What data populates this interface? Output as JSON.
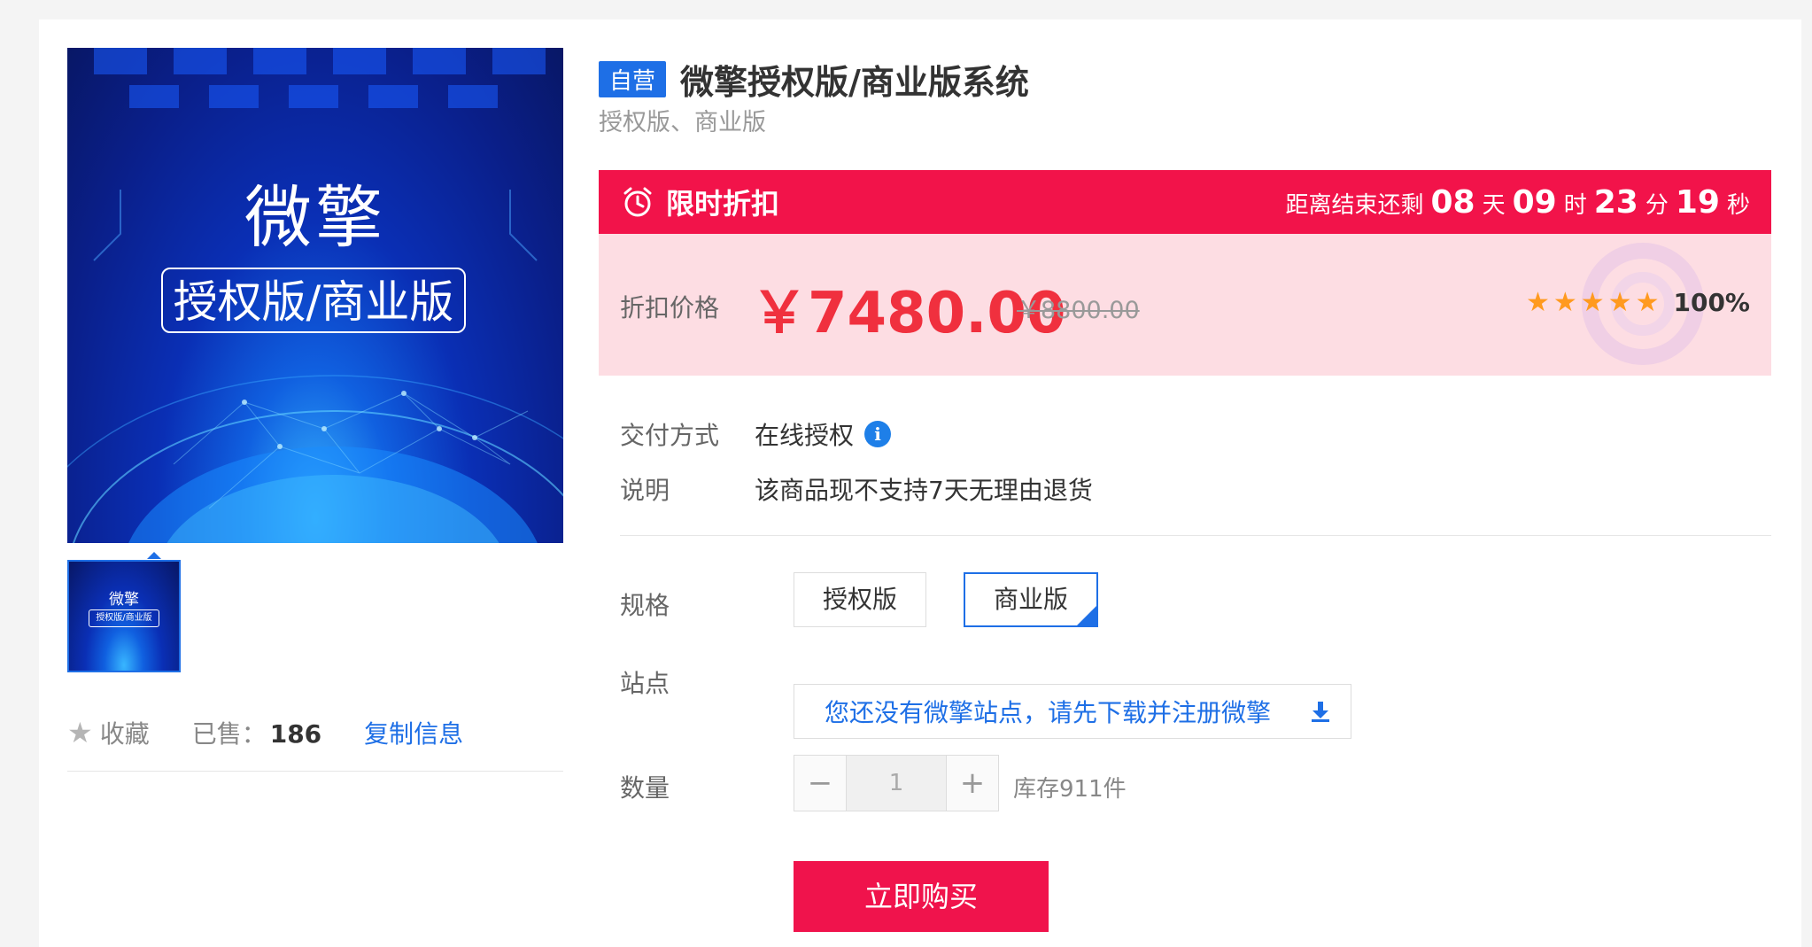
{
  "gallery": {
    "main_image_title": "微擎",
    "main_image_subtitle": "授权版/商业版",
    "thumb_title": "微擎",
    "thumb_subtitle": "授权版/商业版"
  },
  "meta": {
    "favorite_label": "收藏",
    "sold_label": "已售：",
    "sold_count": "186",
    "copy_label": "复制信息"
  },
  "product": {
    "badge": "自营",
    "title": "微擎授权版/商业版系统",
    "subtitle": "授权版、商业版"
  },
  "promo": {
    "label": "限时折扣",
    "countdown_prefix": "距离结束还剩",
    "days": "08",
    "days_unit": "天",
    "hours": "09",
    "hours_unit": "时",
    "minutes": "23",
    "minutes_unit": "分",
    "seconds": "19",
    "seconds_unit": "秒"
  },
  "price": {
    "label": "折扣价格",
    "current": "￥7480.00",
    "original": "￥8800.00",
    "rating_stars": 5,
    "rating_percent": "100%"
  },
  "info": {
    "delivery_label": "交付方式",
    "delivery_value": "在线授权",
    "note_label": "说明",
    "note_value": "该商品现不支持7天无理由退货"
  },
  "spec": {
    "label": "规格",
    "options": [
      "授权版",
      "商业版"
    ],
    "selected": "商业版"
  },
  "site": {
    "label": "站点",
    "prompt": "您还没有微擎站点，请先下载并注册微擎"
  },
  "quantity": {
    "label": "数量",
    "value": "1",
    "minus": "−",
    "plus": "+",
    "stock": "库存911件"
  },
  "buy_button": "立即购买",
  "colors": {
    "accent_blue": "#1e6fe6",
    "promo_red": "#f2134a",
    "price_red": "#f0303e",
    "star_orange": "#ff9a1f"
  }
}
